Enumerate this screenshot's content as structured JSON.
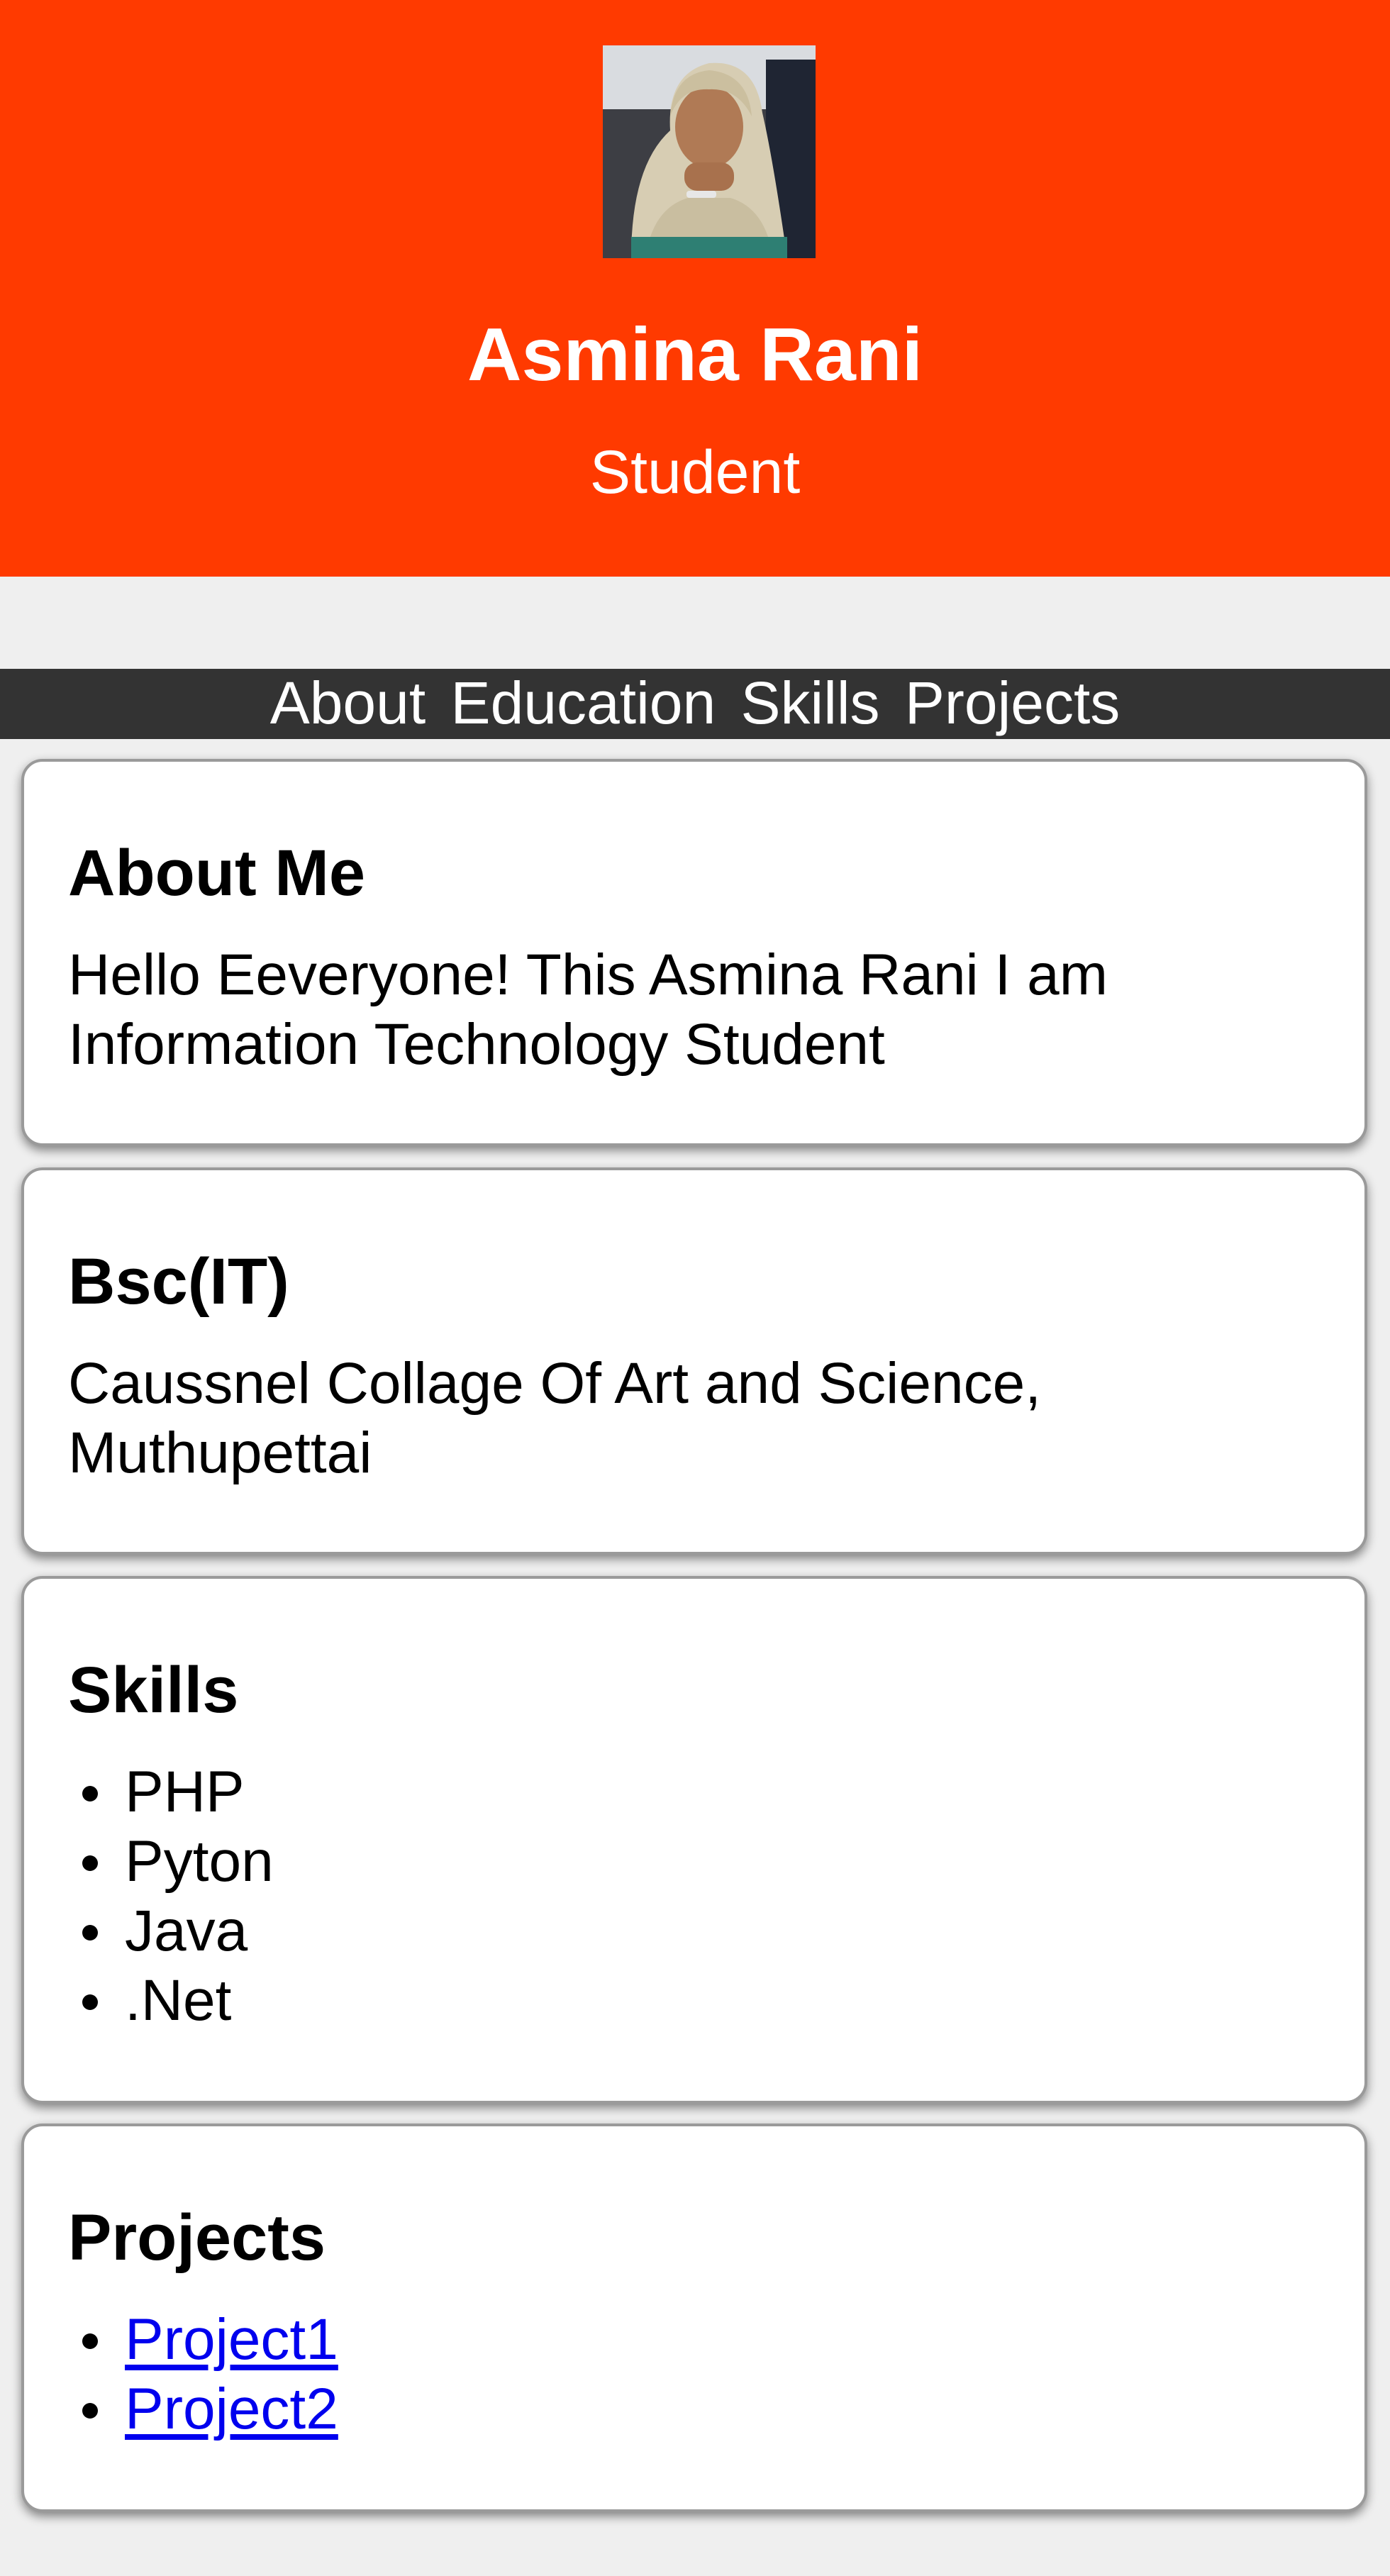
{
  "header": {
    "name": "Asmina Rani",
    "role": "Student",
    "avatar_alt": "profile photo"
  },
  "nav": {
    "items": [
      "About",
      "Education",
      "Skills",
      "Projects"
    ]
  },
  "about": {
    "title": "About Me",
    "text": "Hello Eeveryone! This Asmina Rani I am Information Technology Student"
  },
  "education": {
    "title": "Bsc(IT)",
    "text": "Caussnel Collage Of Art and Science, Muthupettai"
  },
  "skills": {
    "title": "Skills",
    "items": [
      "PHP",
      "Pyton",
      "Java",
      ".Net"
    ]
  },
  "projects": {
    "title": "Projects",
    "items": [
      "Project1",
      "Project2"
    ]
  },
  "colors": {
    "header_bg": "#ff3a00",
    "nav_bg": "#333333",
    "page_bg": "#efefef",
    "link": "#0000ee"
  }
}
